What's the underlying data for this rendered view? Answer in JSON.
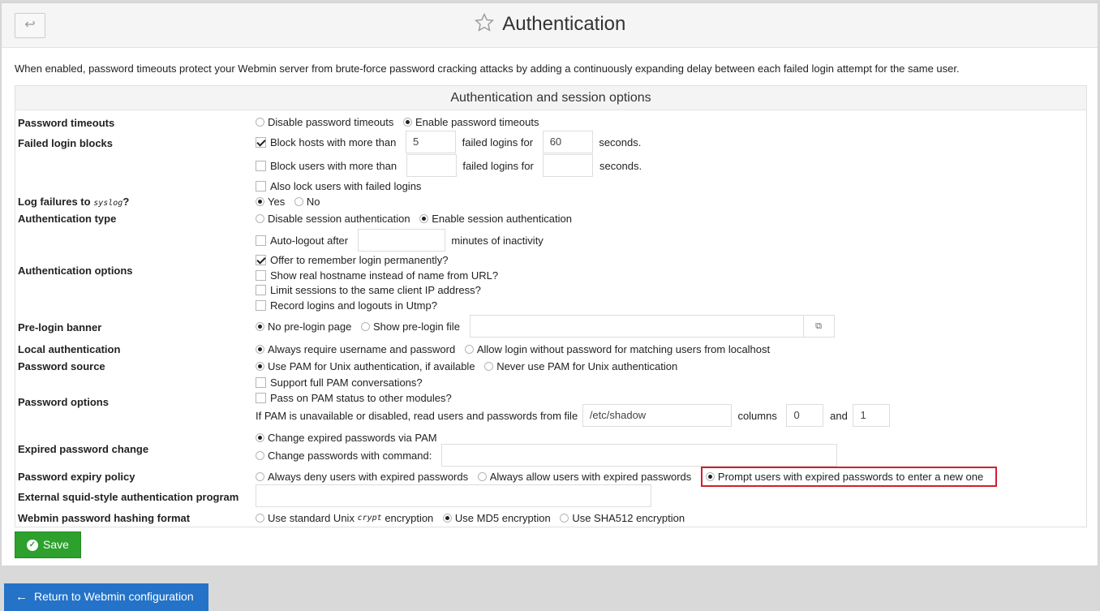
{
  "header": {
    "back_glyph": "↩",
    "title": "Authentication",
    "star_icon": "star-outline-icon"
  },
  "intro": "When enabled, password timeouts protect your Webmin server from brute-force password cracking attacks by adding a continuously expanding delay between each failed login attempt for the same user.",
  "section_title": "Authentication and session options",
  "labels": {
    "password_timeouts": "Password timeouts",
    "failed_login_blocks": "Failed login blocks",
    "log_failures_a": "Log failures to",
    "log_failures_code": "syslog",
    "log_failures_b": "?",
    "authentication_type": "Authentication type",
    "authentication_options": "Authentication options",
    "pre_login_banner": "Pre-login banner",
    "local_authentication": "Local authentication",
    "password_source": "Password source",
    "password_options": "Password options",
    "expired_password_change": "Expired password change",
    "password_expiry_policy": "Password expiry policy",
    "external_squid": "External squid-style authentication program",
    "hashing_format": "Webmin password hashing format"
  },
  "options": {
    "disable_timeouts": "Disable password timeouts",
    "enable_timeouts": "Enable password timeouts",
    "block_hosts": "Block hosts with more than",
    "block_hosts_count": "5",
    "failed_logins_for": "failed logins for",
    "block_hosts_seconds": "60",
    "seconds": "seconds.",
    "block_users": "Block users with more than",
    "block_users_count": "",
    "block_users_seconds": "",
    "lock_users": "Also lock users with failed logins",
    "yes": "Yes",
    "no": "No",
    "disable_session": "Disable session authentication",
    "enable_session": "Enable session authentication",
    "auto_logout": "Auto-logout after",
    "auto_logout_value": "",
    "minutes_inactivity": "minutes of inactivity",
    "remember_login": "Offer to remember login permanently?",
    "real_hostname": "Show real hostname instead of name from URL?",
    "limit_sessions": "Limit sessions to the same client IP address?",
    "record_logins": "Record logins and logouts in Utmp?",
    "no_prelogin": "No pre-login page",
    "show_prelogin": "Show pre-login file",
    "prelogin_file_value": "",
    "always_require": "Always require username and password",
    "allow_without": "Allow login without password for matching users from localhost",
    "use_pam": "Use PAM for Unix authentication, if available",
    "never_pam": "Never use PAM for Unix authentication",
    "full_pam": "Support full PAM conversations?",
    "pass_pam": "Pass on PAM status to other modules?",
    "pam_unavailable": "If PAM is unavailable or disabled, read users and passwords from file",
    "shadow_file": "/etc/shadow",
    "columns": "columns",
    "columns_value": "0",
    "and": "and",
    "and_value": "1",
    "change_via_pam": "Change expired passwords via PAM",
    "change_with_command": "Change passwords with command:",
    "command_value": "",
    "always_deny": "Always deny users with expired passwords",
    "always_allow": "Always allow users with expired passwords",
    "prompt_users": "Prompt users with expired passwords to enter a new one",
    "squid_value": "",
    "use_standard_a": "Use standard Unix",
    "use_standard_code": "crypt",
    "use_standard_b": "encryption",
    "use_md5": "Use MD5 encryption",
    "use_sha512": "Use SHA512 encryption"
  },
  "buttons": {
    "save": "Save",
    "return": "Return to Webmin configuration"
  },
  "colors": {
    "save_green": "#2da02d",
    "return_blue": "#2473c8",
    "highlight_red": "#d0202e"
  }
}
